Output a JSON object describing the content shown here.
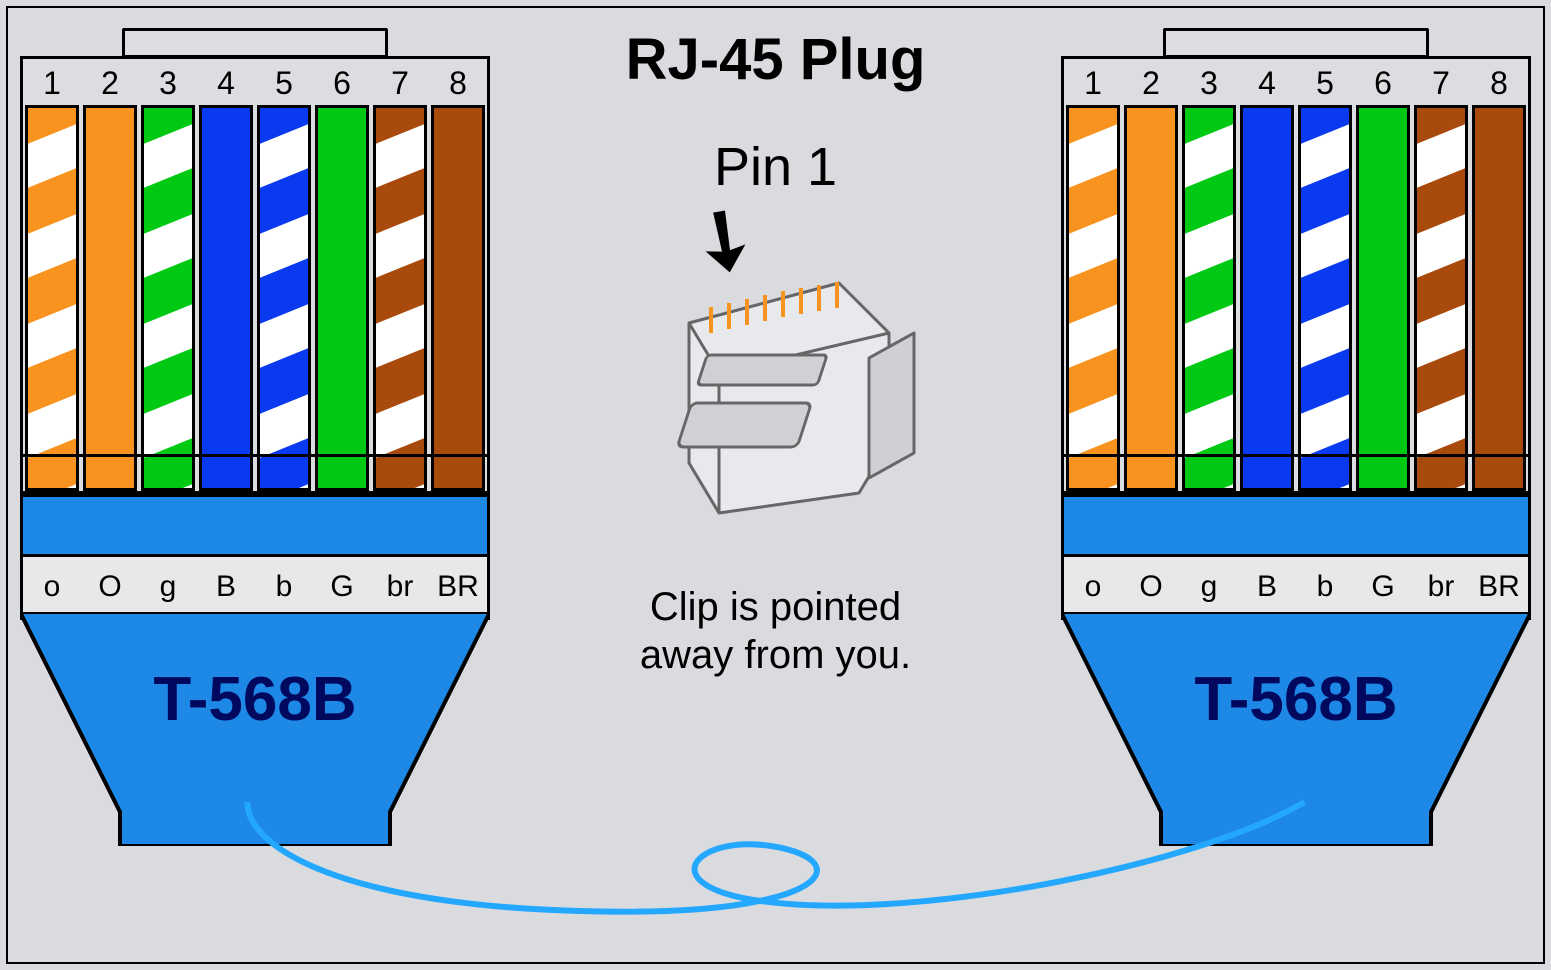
{
  "title": "RJ-45 Plug",
  "pin1_label": "Pin 1",
  "clip_note_l1": "Clip is pointed",
  "clip_note_l2": "away from you.",
  "connectors": {
    "standard_label": "T-568B",
    "pins": [
      "1",
      "2",
      "3",
      "4",
      "5",
      "6",
      "7",
      "8"
    ],
    "abbr": [
      "o",
      "O",
      "g",
      "B",
      "b",
      "G",
      "br",
      "BR"
    ],
    "wires": [
      {
        "type": "striped",
        "color": "orange",
        "class": "c-orange",
        "name": "white-orange"
      },
      {
        "type": "solid",
        "color": "orange",
        "class": "c-orange",
        "name": "orange"
      },
      {
        "type": "striped",
        "color": "green",
        "class": "c-green",
        "name": "white-green"
      },
      {
        "type": "solid",
        "color": "blue",
        "class": "c-blue",
        "name": "blue"
      },
      {
        "type": "striped",
        "color": "blue",
        "class": "c-blue",
        "name": "white-blue"
      },
      {
        "type": "solid",
        "color": "green",
        "class": "c-green",
        "name": "green"
      },
      {
        "type": "striped",
        "color": "brown",
        "class": "c-brown",
        "name": "white-brown"
      },
      {
        "type": "solid",
        "color": "brown",
        "class": "c-brown",
        "name": "brown"
      }
    ]
  },
  "colors": {
    "orange": "#f7931e",
    "green": "#00c914",
    "blue": "#0a3af0",
    "brown": "#a84a0b",
    "boot": "#1d88e6",
    "cable": "#24a7ff",
    "std_text": "#00095e",
    "bg": "#dadbdf"
  }
}
